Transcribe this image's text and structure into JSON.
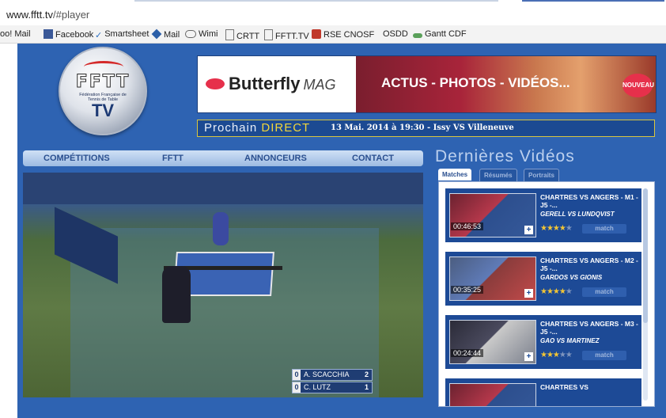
{
  "browser": {
    "url_host": "www.fftt.tv",
    "url_path": "/#player",
    "bookmarks": [
      {
        "label": "oo! Mail",
        "icon": "mail-icon"
      },
      {
        "label": "Facebook",
        "icon": "facebook-icon"
      },
      {
        "label": "Smartsheet",
        "icon": "check-icon"
      },
      {
        "label": "Mail",
        "icon": "mail-diamond-icon"
      },
      {
        "label": "Wimi",
        "icon": "cloud-icon"
      },
      {
        "label": "CRTT",
        "icon": "page-icon"
      },
      {
        "label": "FFTT.TV",
        "icon": "page-icon"
      },
      {
        "label": "RSE CNOSF",
        "icon": "rings-icon"
      },
      {
        "label": "OSDD",
        "icon": ""
      },
      {
        "label": "Gantt CDF",
        "icon": "gantt-icon"
      }
    ]
  },
  "logo": {
    "letters": "FFTT",
    "subtitle": "Fédération Française de Tennis de Table",
    "tv": "TV"
  },
  "banner": {
    "brand": "Butterfly",
    "brand_suffix": "MAG",
    "tagline": "ACTUS - PHOTOS - VIDÉOS...",
    "badge": "NOUVEAU"
  },
  "direct": {
    "prefix": "Prochain",
    "highlight": "DIRECT",
    "info": "13 Mai. 2014 à 19:30 - Issy VS Villeneuve"
  },
  "nav": {
    "items": [
      "COMPÉTITIONS",
      "FFTT",
      "ANNONCEURS",
      "CONTACT"
    ]
  },
  "player": {
    "score": [
      {
        "set": "0",
        "name": "A. SCACCHIA",
        "points": "2"
      },
      {
        "set": "0",
        "name": "C. LUTZ",
        "points": "1"
      }
    ]
  },
  "videos": {
    "title": "Dernières Vidéos",
    "tabs": [
      "Matches",
      "Résumés",
      "Portraits / Itw"
    ],
    "active_tab": "Matches",
    "items": [
      {
        "title": "CHARTRES VS ANGERS - M1 - J5 -...",
        "players": "GERELL VS LUNDQVIST",
        "time": "00:46:53",
        "rating": 4,
        "category": "match"
      },
      {
        "title": "CHARTRES VS ANGERS - M2 - J5 -...",
        "players": "GARDOS VS GIONIS",
        "time": "00:35:25",
        "rating": 4,
        "category": "match"
      },
      {
        "title": "CHARTRES VS ANGERS - M3 - J5 -...",
        "players": "GAO VS MARTINEZ",
        "time": "00:24:44",
        "rating": 3,
        "category": "match"
      },
      {
        "title": "CHARTRES VS",
        "players": "",
        "time": "",
        "rating": 0,
        "category": ""
      }
    ]
  },
  "colors": {
    "site_bg": "#2e63b2",
    "accent_yellow": "#f2d63b",
    "brand_red": "#e6304b"
  }
}
